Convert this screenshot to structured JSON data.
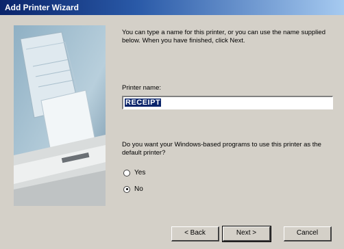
{
  "window": {
    "title": "Add Printer Wizard"
  },
  "intro_text": "You can type a name for this printer, or you can use the name supplied below. When you have finished, click Next.",
  "printer_name": {
    "label": "Printer name:",
    "value": "RECEIPT"
  },
  "question": "Do you want your Windows-based programs to use this printer as the default printer?",
  "default_printer_options": [
    {
      "label": "Yes",
      "selected": false
    },
    {
      "label": "No",
      "selected": true
    }
  ],
  "buttons": {
    "back": "< Back",
    "next": "Next >",
    "cancel": "Cancel"
  },
  "colors": {
    "titlebar": "#0a246a",
    "face": "#d4d0c8",
    "selection": "#0a246a"
  }
}
